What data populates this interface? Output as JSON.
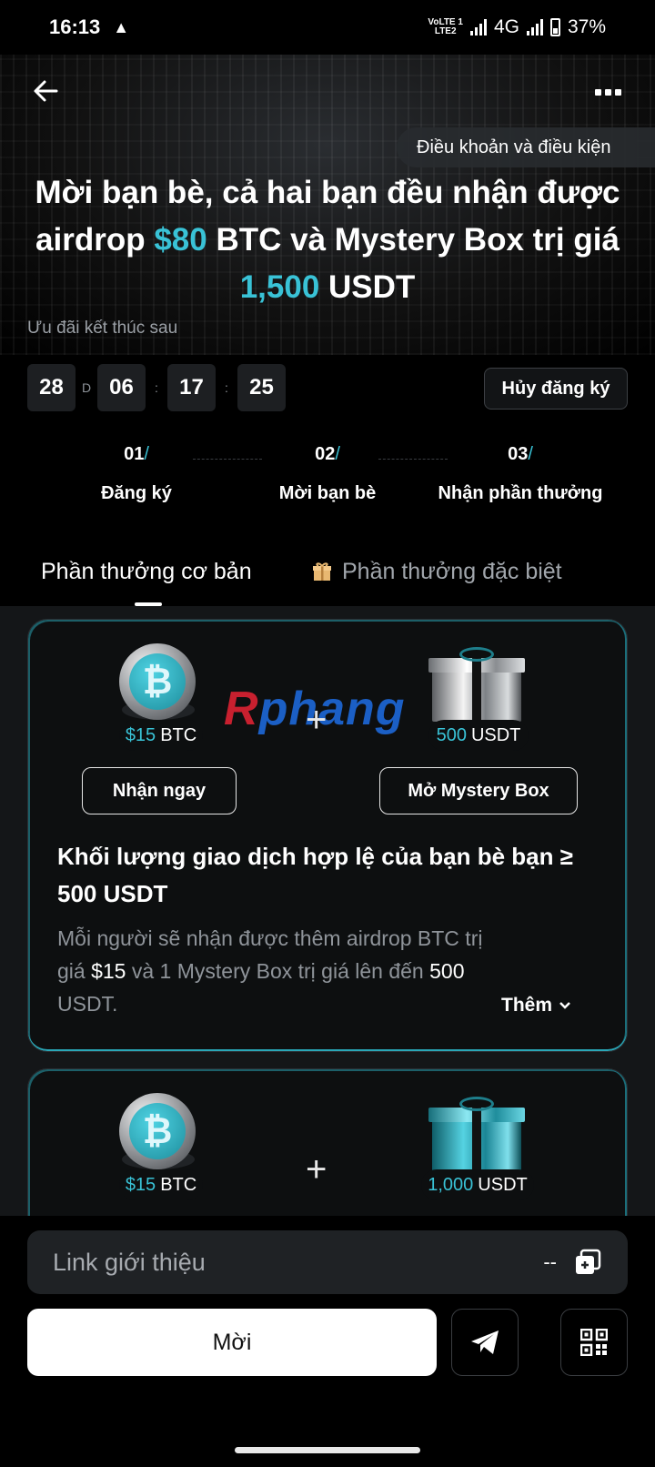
{
  "status_bar": {
    "time": "16:13",
    "network_top": "VoLTE 1",
    "network_bottom": "LTE2",
    "network_type": "4G",
    "battery": "37%"
  },
  "header": {
    "terms_label": "Điều khoản và điều kiện"
  },
  "hero": {
    "line1": "Mời bạn bè, cả hai bạn đều nhận được",
    "line2_pre": "airdrop ",
    "line2_amount": "$80",
    "line2_post": " BTC và Mystery Box trị giá",
    "line3_amount": "1,500",
    "line3_post": " USDT"
  },
  "countdown": {
    "label": "Ưu đãi kết thúc sau",
    "days": "28",
    "days_unit": "D",
    "hours": "06",
    "minutes": "17",
    "seconds": "25",
    "sep": ":"
  },
  "unsubscribe_label": "Hủy đăng ký",
  "steps": [
    {
      "num": "01",
      "label": "Đăng ký"
    },
    {
      "num": "02",
      "label": "Mời bạn bè"
    },
    {
      "num": "03",
      "label": "Nhận phần thưởng"
    }
  ],
  "step_slash": "/",
  "tabs": [
    {
      "label": "Phần thưởng cơ bản",
      "active": true
    },
    {
      "label": "Phần thưởng đặc biệt",
      "active": false
    }
  ],
  "watermark": {
    "part1": "R",
    "part2": "phang"
  },
  "cards": [
    {
      "btc_amount": "$15",
      "btc_unit": "BTC",
      "box_amount": "500",
      "box_unit": "USDT",
      "plus": "+",
      "claim_label": "Nhận ngay",
      "open_label": "Mở Mystery Box",
      "title": "Khối lượng giao dịch hợp lệ của bạn bè bạn ≥ 500 USDT",
      "desc_1": "Mỗi người sẽ nhận được thêm airdrop BTC trị giá ",
      "desc_amount": "$15",
      "desc_2": " và 1 Mystery Box trị giá lên đến ",
      "desc_box": "500",
      "desc_3": " USDT.",
      "more_label": "Thêm"
    },
    {
      "btc_amount": "$15",
      "btc_unit": "BTC",
      "box_amount": "1,000",
      "box_unit": "USDT",
      "plus": "+"
    }
  ],
  "referral": {
    "placeholder": "Link giới thiệu",
    "value": "--"
  },
  "invite_label": "Mời",
  "colors": {
    "accent": "#39c2d6",
    "background": "#000000",
    "card": "#0d0f10"
  },
  "icons": [
    "back-arrow-icon",
    "more-icon",
    "gift-icon",
    "copy-icon",
    "telegram-icon",
    "qr-code-icon",
    "chevron-down-icon",
    "bitcoin-icon"
  ]
}
